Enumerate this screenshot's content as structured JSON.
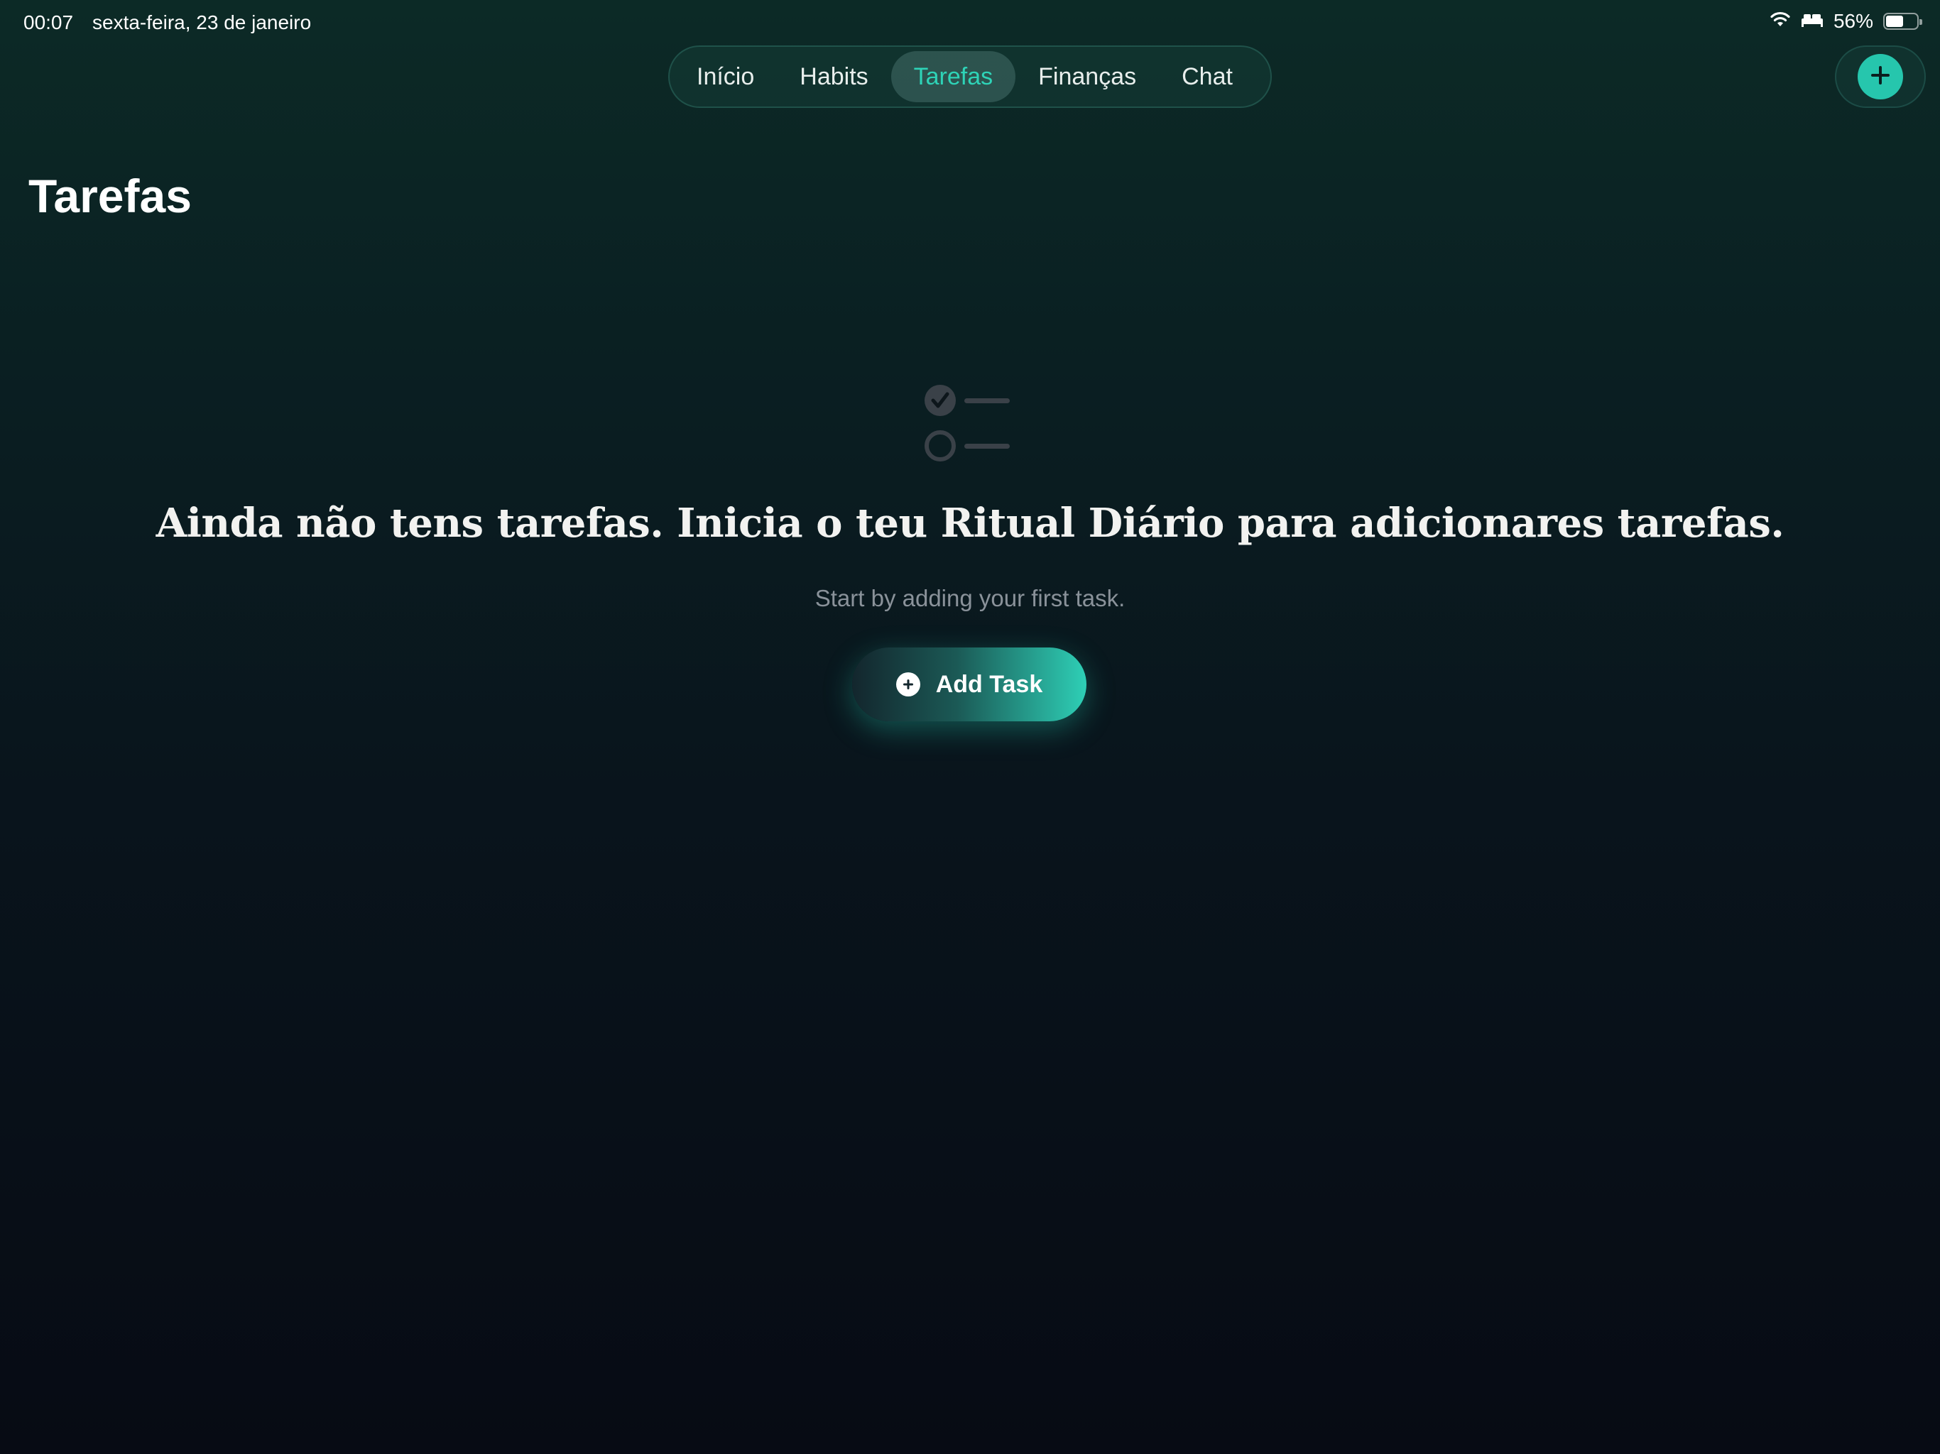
{
  "status_bar": {
    "time": "00:07",
    "date": "sexta-feira, 23 de janeiro",
    "battery_percent": "56%",
    "battery_level": 0.56,
    "icons": [
      "wifi-icon",
      "bed-icon",
      "battery-icon"
    ]
  },
  "nav": {
    "tabs": [
      {
        "label": "Início",
        "active": false
      },
      {
        "label": "Habits",
        "active": false
      },
      {
        "label": "Tarefas",
        "active": true
      },
      {
        "label": "Finanças",
        "active": false
      },
      {
        "label": "Chat",
        "active": false
      }
    ],
    "add_icon": "plus-icon"
  },
  "page": {
    "title": "Tarefas"
  },
  "empty_state": {
    "icon": "checklist-icon",
    "heading": "Ainda não tens tarefas. Inicia o teu Ritual Diário para adicionares tarefas.",
    "subtext": "Start by adding your first task.",
    "button_label": "Add Task",
    "button_icon": "plus-circle-icon"
  },
  "colors": {
    "accent": "#2ed3b7",
    "background_top": "#0c2a26",
    "background_bottom": "#070b14"
  }
}
